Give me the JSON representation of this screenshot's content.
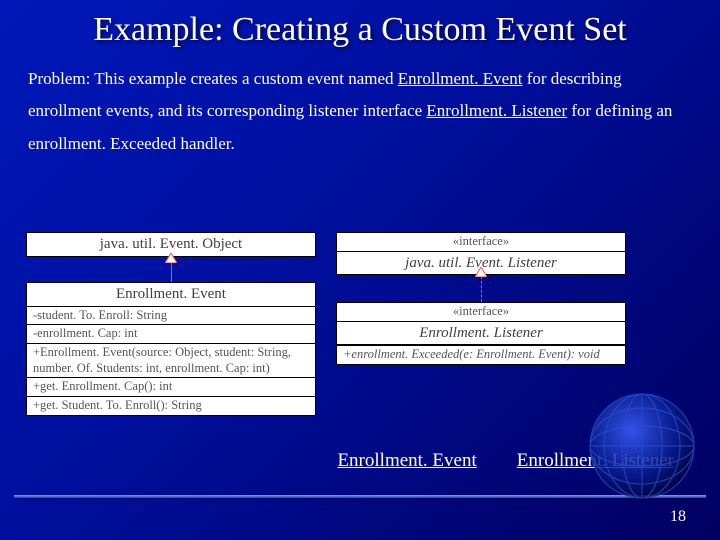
{
  "title": "Example: Creating a Custom Event Set",
  "problem": {
    "prefix": "Problem: This example creates a custom event named ",
    "u1": "Enrollment. Event",
    "mid1": " for describing enrollment events, and its corresponding listener interface ",
    "u2": "Enrollment. Listener",
    "mid2": " for defining an enrollment. Exceeded handler."
  },
  "uml": {
    "event_object": "java. util. Event. Object",
    "event_listener_stereo": "«interface»",
    "event_listener": "java. util. Event. Listener",
    "enrollment_event": {
      "name": "Enrollment. Event",
      "attr1": "-student. To. Enroll: String",
      "attr2": "-enrollment. Cap: int",
      "op1": "+Enrollment. Event(source: Object, student: String, number. Of. Students: int, enrollment. Cap: int)",
      "op2": "+get. Enrollment. Cap(): int",
      "op3": "+get. Student. To. Enroll(): String"
    },
    "enrollment_listener": {
      "stereo": "«interface»",
      "name": "Enrollment. Listener",
      "op1": "+enrollment. Exceeded(e: Enrollment. Event): void"
    }
  },
  "links": {
    "event": "Enrollment. Event",
    "listener": "Enrollment. Listener"
  },
  "page_number": "18"
}
